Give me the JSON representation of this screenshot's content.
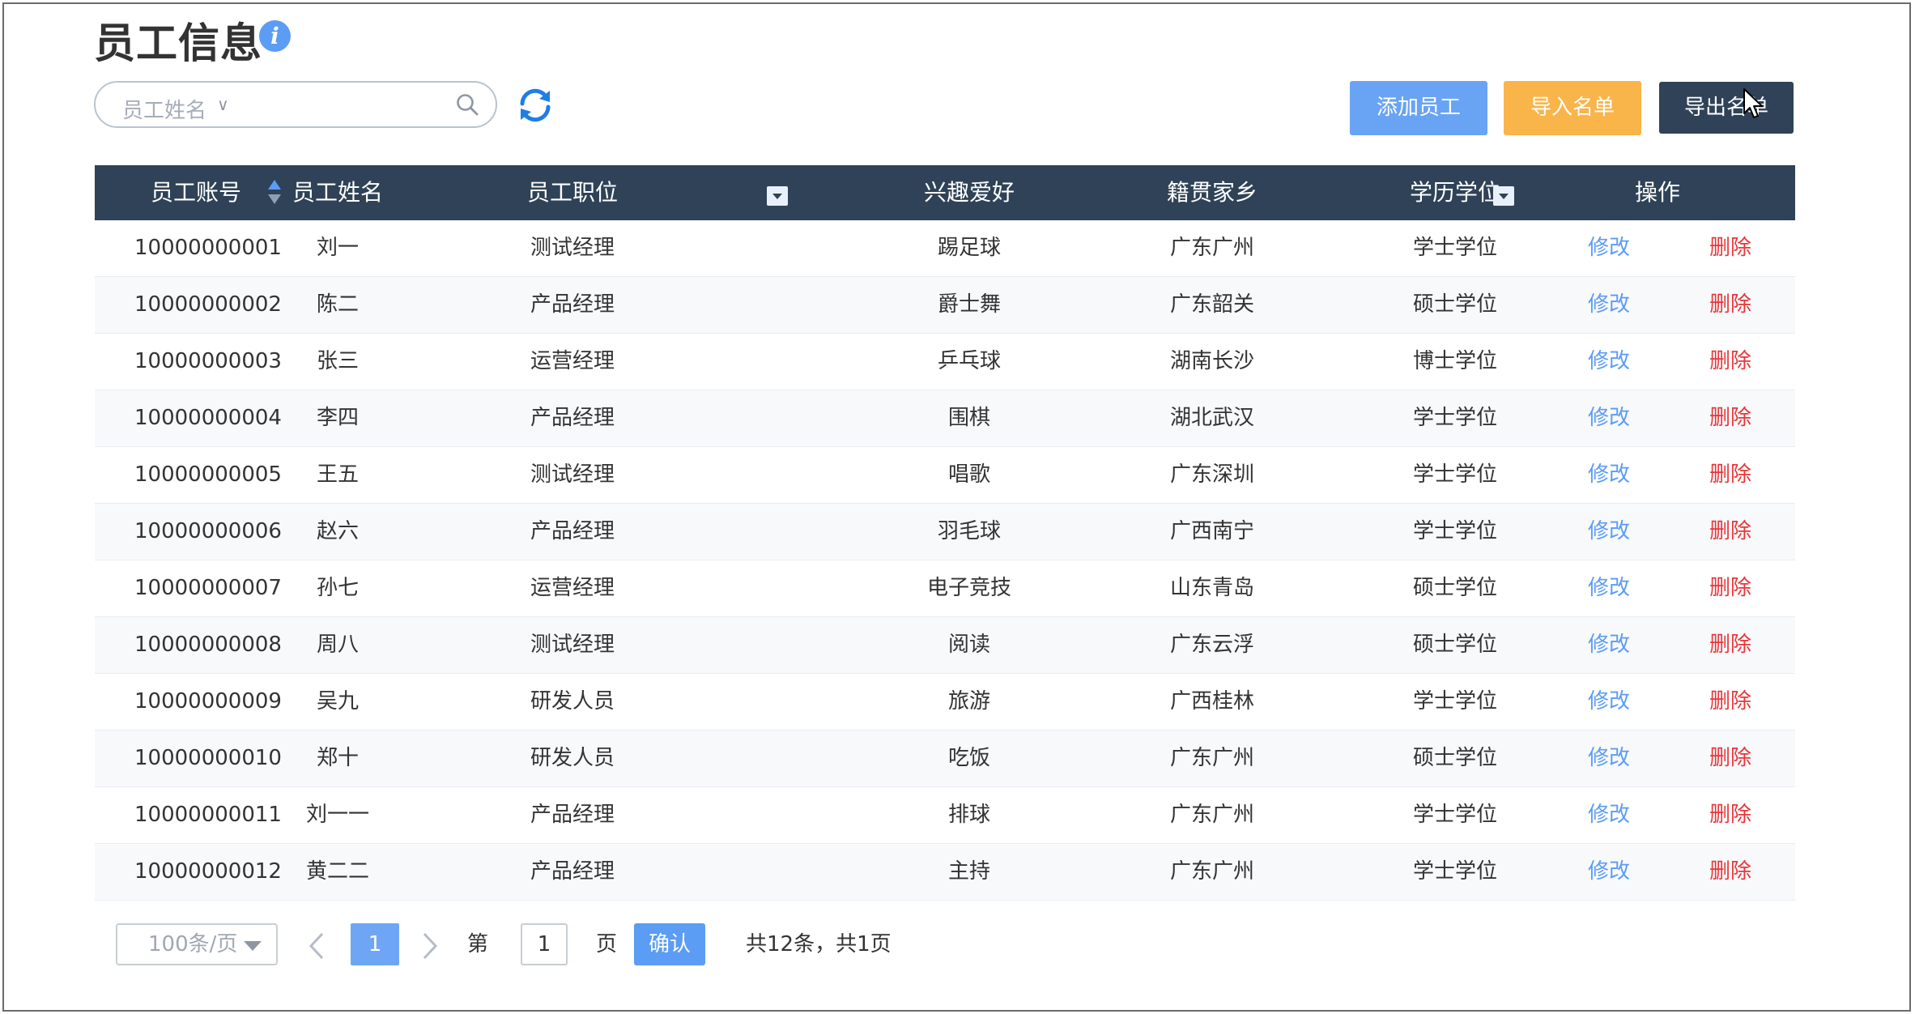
{
  "page": {
    "title": "员工信息",
    "info_icon": "info-icon",
    "info_glyph": "i"
  },
  "search": {
    "field_label": "员工姓名",
    "caret": "∨"
  },
  "toolbar": {
    "add_label": "添加员工",
    "import_label": "导入名单",
    "export_label": "导出名单"
  },
  "colors": {
    "header_bg": "#2f4257",
    "add_button": "#69a4f4",
    "import_button": "#f9b44a",
    "export_button": "#2f4257",
    "link_edit": "#5b9cf5",
    "link_delete": "#e8363a"
  },
  "table": {
    "headers": {
      "account": "员工账号",
      "name": "员工姓名",
      "position": "员工职位",
      "hobby": "兴趣爱好",
      "hometown": "籍贯家乡",
      "degree": "学历学位",
      "actions": "操作"
    },
    "edit_label": "修改",
    "delete_label": "删除",
    "rows": [
      {
        "account": "10000000001",
        "name": "刘一",
        "position": "测试经理",
        "hobby": "踢足球",
        "hometown": "广东广州",
        "degree": "学士学位"
      },
      {
        "account": "10000000002",
        "name": "陈二",
        "position": "产品经理",
        "hobby": "爵士舞",
        "hometown": "广东韶关",
        "degree": "硕士学位"
      },
      {
        "account": "10000000003",
        "name": "张三",
        "position": "运营经理",
        "hobby": "乒乓球",
        "hometown": "湖南长沙",
        "degree": "博士学位"
      },
      {
        "account": "10000000004",
        "name": "李四",
        "position": "产品经理",
        "hobby": "围棋",
        "hometown": "湖北武汉",
        "degree": "学士学位"
      },
      {
        "account": "10000000005",
        "name": "王五",
        "position": "测试经理",
        "hobby": "唱歌",
        "hometown": "广东深圳",
        "degree": "学士学位"
      },
      {
        "account": "10000000006",
        "name": "赵六",
        "position": "产品经理",
        "hobby": "羽毛球",
        "hometown": "广西南宁",
        "degree": "学士学位"
      },
      {
        "account": "10000000007",
        "name": "孙七",
        "position": "运营经理",
        "hobby": "电子竞技",
        "hometown": "山东青岛",
        "degree": "硕士学位"
      },
      {
        "account": "10000000008",
        "name": "周八",
        "position": "测试经理",
        "hobby": "阅读",
        "hometown": "广东云浮",
        "degree": "硕士学位"
      },
      {
        "account": "10000000009",
        "name": "吴九",
        "position": "研发人员",
        "hobby": "旅游",
        "hometown": "广西桂林",
        "degree": "学士学位"
      },
      {
        "account": "10000000010",
        "name": "郑十",
        "position": "研发人员",
        "hobby": "吃饭",
        "hometown": "广东广州",
        "degree": "硕士学位"
      },
      {
        "account": "10000000011",
        "name": "刘一一",
        "position": "产品经理",
        "hobby": "排球",
        "hometown": "广东广州",
        "degree": "学士学位"
      },
      {
        "account": "10000000012",
        "name": "黄二二",
        "position": "产品经理",
        "hobby": "主持",
        "hometown": "广东广州",
        "degree": "学士学位"
      }
    ]
  },
  "pagination": {
    "page_size": "100条/页",
    "current_page": "1",
    "goto_prefix": "第",
    "goto_value": "1",
    "goto_suffix": "页",
    "confirm_label": "确认",
    "summary": "共12条，共1页"
  }
}
